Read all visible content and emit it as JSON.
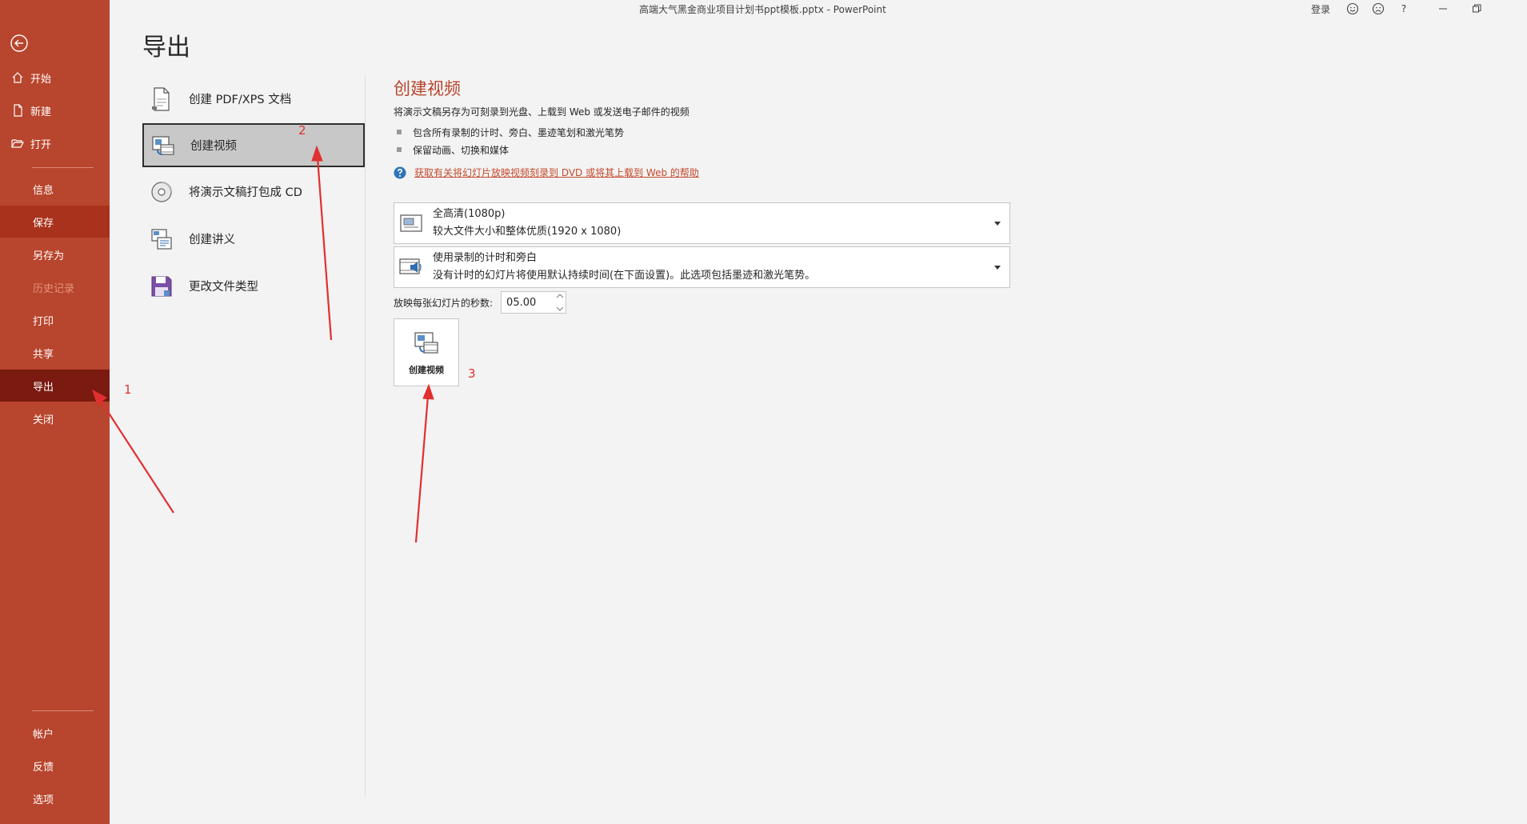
{
  "titlebar": {
    "document_title": "高端大气黑金商业项目计划书ppt模板.pptx  -  PowerPoint",
    "login": "登录",
    "icons": [
      "smiley-icon",
      "frown-icon",
      "help-icon",
      "minimize-icon",
      "restore-icon"
    ],
    "help_glyph": "?"
  },
  "sidebar": {
    "top_items": [
      {
        "label": "开始",
        "icon": "home-icon"
      },
      {
        "label": "新建",
        "icon": "new-file-icon"
      },
      {
        "label": "打开",
        "icon": "folder-open-icon"
      }
    ],
    "items": [
      {
        "label": "信息"
      },
      {
        "label": "保存"
      },
      {
        "label": "另存为"
      },
      {
        "label": "历史记录"
      },
      {
        "label": "打印"
      },
      {
        "label": "共享"
      },
      {
        "label": "导出"
      },
      {
        "label": "关闭"
      }
    ],
    "bottom_items": [
      {
        "label": "帐户"
      },
      {
        "label": "反馈"
      },
      {
        "label": "选项"
      }
    ],
    "active": "导出",
    "accent_color": "#b8452d"
  },
  "page": {
    "title": "导出"
  },
  "export_options": [
    {
      "label": "创建 PDF/XPS 文档",
      "icon": "pdf-document-icon"
    },
    {
      "label": "创建视频",
      "icon": "video-icon"
    },
    {
      "label": "将演示文稿打包成 CD",
      "icon": "cd-icon"
    },
    {
      "label": "创建讲义",
      "icon": "handout-icon"
    },
    {
      "label": "更改文件类型",
      "icon": "save-file-type-icon"
    }
  ],
  "detail": {
    "title": "创建视频",
    "description": "将演示文稿另存为可刻录到光盘、上载到 Web 或发送电子邮件的视频",
    "bullets": [
      "包含所有录制的计时、旁白、墨迹笔划和激光笔势",
      "保留动画、切换和媒体"
    ],
    "help_link": "获取有关将幻灯片放映视频刻录到 DVD 或将其上载到 Web 的帮助",
    "quality_dropdown": {
      "line1": "全高清(1080p)",
      "line2": "较大文件大小和整体优质(1920 x 1080)"
    },
    "timing_dropdown": {
      "line1": "使用录制的计时和旁白",
      "line2": "没有计时的幻灯片将使用默认持续时间(在下面设置)。此选项包括墨迹和激光笔势。"
    },
    "seconds_label": "放映每张幻灯片的秒数:",
    "seconds_value": "05.00",
    "create_button_label": "创建视频"
  },
  "annotations": {
    "step1": "1",
    "step2": "2",
    "step3": "3",
    "color": "#e03030"
  }
}
